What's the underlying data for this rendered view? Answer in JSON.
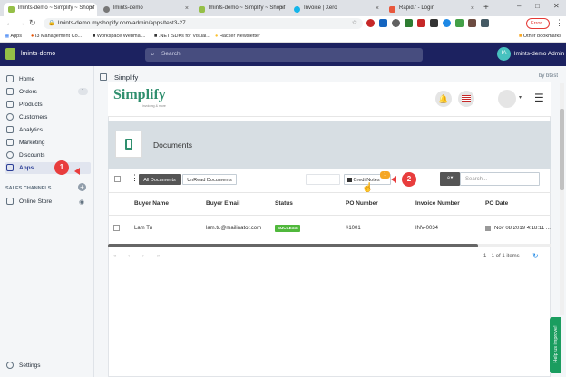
{
  "browser": {
    "tabs": [
      {
        "label": "lmints-demo ~ Simplify ~ Shopif",
        "active": true
      },
      {
        "label": "lmints-demo",
        "active": false
      },
      {
        "label": "lmints-demo ~ Simplify ~ Shopif",
        "active": false
      },
      {
        "label": "Invoice | Xero",
        "active": false
      },
      {
        "label": "Rapid7 - Login",
        "active": false
      }
    ],
    "new_tab": "+",
    "url": "lmints-demo.myshopify.com/admin/apps/test3-27",
    "error_label": "Error",
    "window_controls": [
      "–",
      "□",
      "✕"
    ]
  },
  "bookmarks": {
    "items": [
      "Apps",
      "I3 Management Co...",
      "Workspace Webmai...",
      ".NET SDKs for Visual...",
      "Hacker Newsletter"
    ],
    "other": "Other bookmarks"
  },
  "shopify": {
    "store_name": "lmints-demo",
    "search_placeholder": "Search",
    "avatar_initials": "IA",
    "user_name": "lmints-demo Admin"
  },
  "sidebar": {
    "items": [
      {
        "label": "Home",
        "icon": "home-icon"
      },
      {
        "label": "Orders",
        "icon": "orders-icon",
        "badge": "1"
      },
      {
        "label": "Products",
        "icon": "tag-icon"
      },
      {
        "label": "Customers",
        "icon": "customers-icon"
      },
      {
        "label": "Analytics",
        "icon": "analytics-icon"
      },
      {
        "label": "Marketing",
        "icon": "marketing-icon"
      },
      {
        "label": "Discounts",
        "icon": "discount-icon"
      },
      {
        "label": "Apps",
        "icon": "apps-icon",
        "active": true
      }
    ],
    "sales_channels_heading": "SALES CHANNELS",
    "online_store": "Online Store",
    "settings": "Settings"
  },
  "app_header": {
    "title": "Simplify",
    "by": "by btest"
  },
  "simplify": {
    "logo_text": "Simplify",
    "logo_sub": "invoicing & more",
    "notification_count": "",
    "page_title": "Documents",
    "filter_all": "All Documents",
    "filter_unread": "UnRead Documents",
    "credit_notes_label": "CreditNotes",
    "credit_notes_badge": "1",
    "search_placeholder": "Search...",
    "more_icon": "⋮"
  },
  "table": {
    "columns": [
      "Buyer Name",
      "Buyer Email",
      "Status",
      "PO Number",
      "Invoice Number",
      "PO Date"
    ],
    "rows": [
      {
        "buyer_name": "Lam Tu",
        "buyer_email": "lam.tu@mailinator.com",
        "status": "SUCCESS",
        "po_number": "#1001",
        "invoice_number": "INV-0034",
        "po_date": "Nov 08 2019 4:18:11 ..."
      }
    ],
    "pagination_summary": "1 - 1 of 1 items",
    "pager": [
      "«",
      "‹",
      "›",
      "»"
    ]
  },
  "callouts": [
    "1",
    "2"
  ],
  "feedback_tab": "Help us improve!",
  "colors": {
    "shopify_topbar": "#1c2260",
    "simplify_teal": "#2f8f6e",
    "callout_red": "#e83d3d",
    "success_green": "#50b83c",
    "badge_orange": "#f5a623"
  }
}
